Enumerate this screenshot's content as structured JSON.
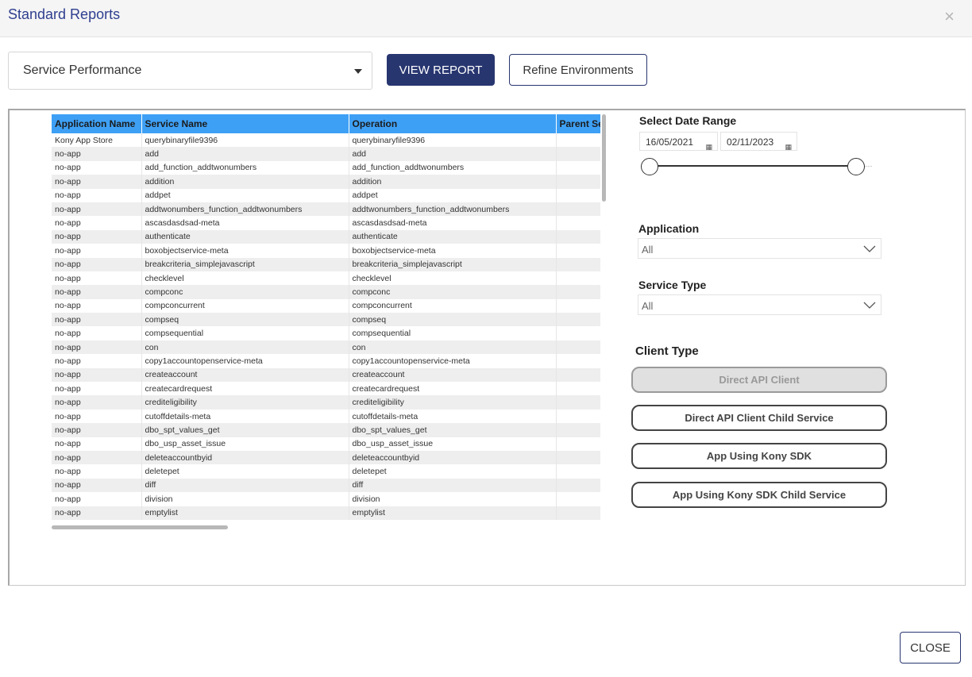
{
  "header": {
    "title": "Standard Reports",
    "close_glyph": "×"
  },
  "report_select": {
    "value": "Service Performance"
  },
  "buttons": {
    "view_report": "VIEW REPORT",
    "refine": "Refine Environments",
    "close": "CLOSE"
  },
  "table": {
    "columns": [
      "Application Name",
      "Service Name",
      "Operation",
      "Parent Se"
    ],
    "rows": [
      [
        "Kony App Store",
        "querybinaryfile9396",
        "querybinaryfile9396",
        ""
      ],
      [
        "no-app",
        "add",
        "add",
        ""
      ],
      [
        "no-app",
        "add_function_addtwonumbers",
        "add_function_addtwonumbers",
        ""
      ],
      [
        "no-app",
        "addition",
        "addition",
        ""
      ],
      [
        "no-app",
        "addpet",
        "addpet",
        ""
      ],
      [
        "no-app",
        "addtwonumbers_function_addtwonumbers",
        "addtwonumbers_function_addtwonumbers",
        ""
      ],
      [
        "no-app",
        "ascasdasdsad-meta",
        "ascasdasdsad-meta",
        ""
      ],
      [
        "no-app",
        "authenticate",
        "authenticate",
        ""
      ],
      [
        "no-app",
        "boxobjectservice-meta",
        "boxobjectservice-meta",
        ""
      ],
      [
        "no-app",
        "breakcriteria_simplejavascript",
        "breakcriteria_simplejavascript",
        ""
      ],
      [
        "no-app",
        "checklevel",
        "checklevel",
        ""
      ],
      [
        "no-app",
        "compconc",
        "compconc",
        ""
      ],
      [
        "no-app",
        "compconcurrent",
        "compconcurrent",
        ""
      ],
      [
        "no-app",
        "compseq",
        "compseq",
        ""
      ],
      [
        "no-app",
        "compsequential",
        "compsequential",
        ""
      ],
      [
        "no-app",
        "con",
        "con",
        ""
      ],
      [
        "no-app",
        "copy1accountopenservice-meta",
        "copy1accountopenservice-meta",
        ""
      ],
      [
        "no-app",
        "createaccount",
        "createaccount",
        ""
      ],
      [
        "no-app",
        "createcardrequest",
        "createcardrequest",
        ""
      ],
      [
        "no-app",
        "crediteligibility",
        "crediteligibility",
        ""
      ],
      [
        "no-app",
        "cutoffdetails-meta",
        "cutoffdetails-meta",
        ""
      ],
      [
        "no-app",
        "dbo_spt_values_get",
        "dbo_spt_values_get",
        ""
      ],
      [
        "no-app",
        "dbo_usp_asset_issue",
        "dbo_usp_asset_issue",
        ""
      ],
      [
        "no-app",
        "deleteaccountbyid",
        "deleteaccountbyid",
        ""
      ],
      [
        "no-app",
        "deletepet",
        "deletepet",
        ""
      ],
      [
        "no-app",
        "diff",
        "diff",
        ""
      ],
      [
        "no-app",
        "division",
        "division",
        ""
      ],
      [
        "no-app",
        "emptylist",
        "emptylist",
        ""
      ]
    ]
  },
  "filters": {
    "date_range": {
      "label": "Select Date Range",
      "start": "16/05/2021",
      "end": "02/11/2023"
    },
    "application": {
      "label": "Application",
      "value": "All"
    },
    "service_type": {
      "label": "Service Type",
      "value": "All"
    },
    "client_type": {
      "label": "Client Type",
      "options": [
        "Direct API Client",
        "Direct API Client Child Service",
        "App Using Kony SDK",
        "App Using Kony SDK Child Service"
      ],
      "selected": "Direct API Client"
    }
  },
  "icons": {
    "dropdown": "caret-down-icon",
    "calendar": "calendar-icon",
    "chevron": "chevron-down-icon"
  }
}
